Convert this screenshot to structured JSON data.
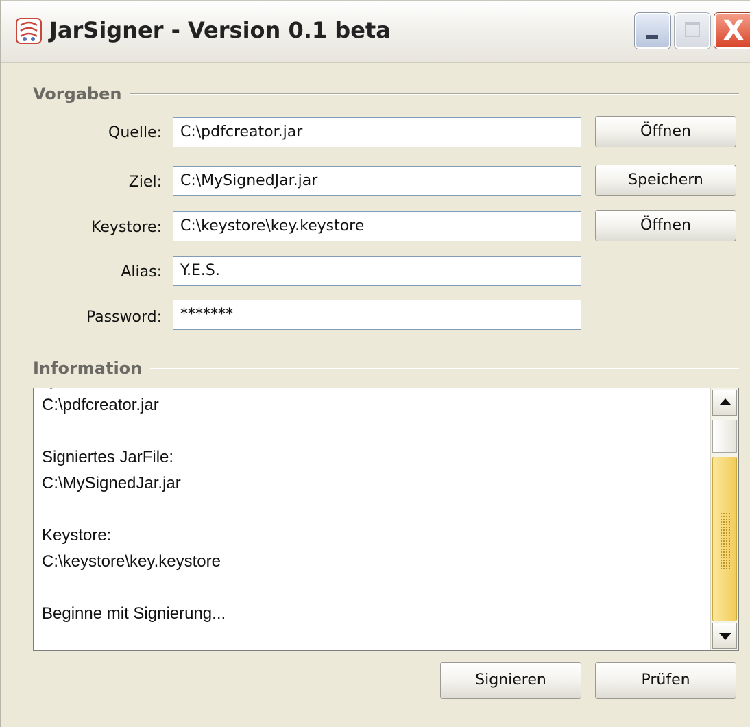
{
  "window": {
    "title": "JarSigner - Version 0.1 beta",
    "icons": {
      "app": "jar-app-icon",
      "minimize": "minimize-icon",
      "maximize": "maximize-icon",
      "close": "close-icon"
    },
    "close_glyph": "X"
  },
  "settings": {
    "section_title": "Vorgaben",
    "fields": [
      {
        "label": "Quelle:",
        "value": "C:\\pdfcreator.jar",
        "button": "Öffnen"
      },
      {
        "label": "Ziel:",
        "value": "C:\\MySignedJar.jar",
        "button": "Speichern"
      },
      {
        "label": "Keystore:",
        "value": "C:\\keystore\\key.keystore",
        "button": "Öffnen"
      },
      {
        "label": "Alias:",
        "value": "Y.E.S."
      },
      {
        "label": "Password:",
        "value": "*******"
      }
    ]
  },
  "information": {
    "section_title": "Information",
    "clipped_top_line": "Quell-JarFile:",
    "lines": [
      "C:\\pdfcreator.jar",
      "",
      "Signiertes JarFile:",
      "C:\\MySignedJar.jar",
      "",
      "Keystore:",
      "C:\\keystore\\key.keystore",
      "",
      "Beginne mit Signierung..."
    ]
  },
  "actions": {
    "sign_label": "Signieren",
    "verify_label": "Prüfen"
  },
  "colors": {
    "window_bg": "#ece9d8",
    "field_border": "#7f9db9",
    "scroll_thumb": "#f1cc5a",
    "close_button": "#d8452a"
  }
}
